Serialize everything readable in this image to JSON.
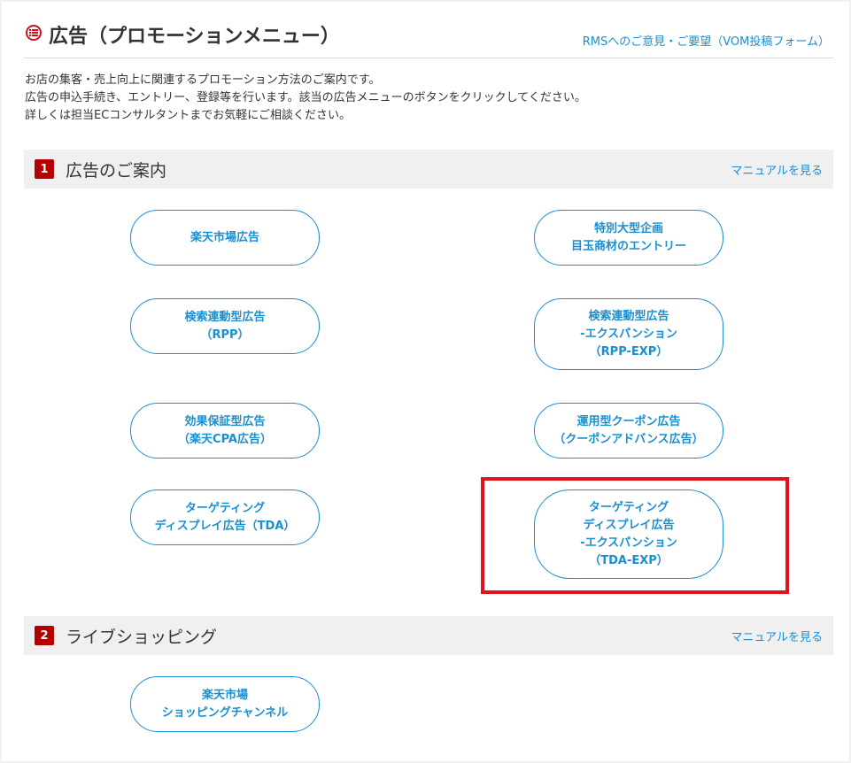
{
  "header": {
    "title": "広告（プロモーションメニュー）",
    "feedback_link": "RMSへのご意見・ご要望（VOM投稿フォーム）"
  },
  "intro": [
    "お店の集客・売上向上に関連するプロモーション方法のご案内です。",
    "広告の申込手続き、エントリー、登録等を行います。該当の広告メニューのボタンをクリックしてください。",
    "詳しくは担当ECコンサルタントまでお気軽にご相談ください。"
  ],
  "sections": [
    {
      "number": "1",
      "title": "広告のご案内",
      "manual_link": "マニュアルを見る",
      "buttons": [
        {
          "lines": [
            "楽天市場広告"
          ]
        },
        {
          "lines": [
            "特別大型企画",
            "目玉商材のエントリー"
          ]
        },
        {
          "lines": [
            "検索連動型広告",
            "（RPP）"
          ]
        },
        {
          "lines": [
            "検索連動型広告",
            "-エクスパンション",
            "（RPP-EXP）"
          ]
        },
        {
          "lines": [
            "効果保証型広告",
            "（楽天CPA広告）"
          ]
        },
        {
          "lines": [
            "運用型クーポン広告",
            "（クーポンアドバンス広告）"
          ]
        },
        {
          "lines": [
            "ターゲティング",
            "ディスプレイ広告（TDA）"
          ]
        },
        {
          "lines": [
            "ターゲティング",
            "ディスプレイ広告",
            "-エクスパンション",
            "（TDA-EXP）"
          ]
        }
      ]
    },
    {
      "number": "2",
      "title": "ライブショッピング",
      "manual_link": "マニュアルを見る",
      "buttons": [
        {
          "lines": [
            "楽天市場",
            "ショッピングチャンネル"
          ]
        }
      ]
    }
  ],
  "colors": {
    "accent_blue": "#1a8fd0",
    "section_badge_red": "#b40000",
    "highlight_red": "#e0141e"
  }
}
